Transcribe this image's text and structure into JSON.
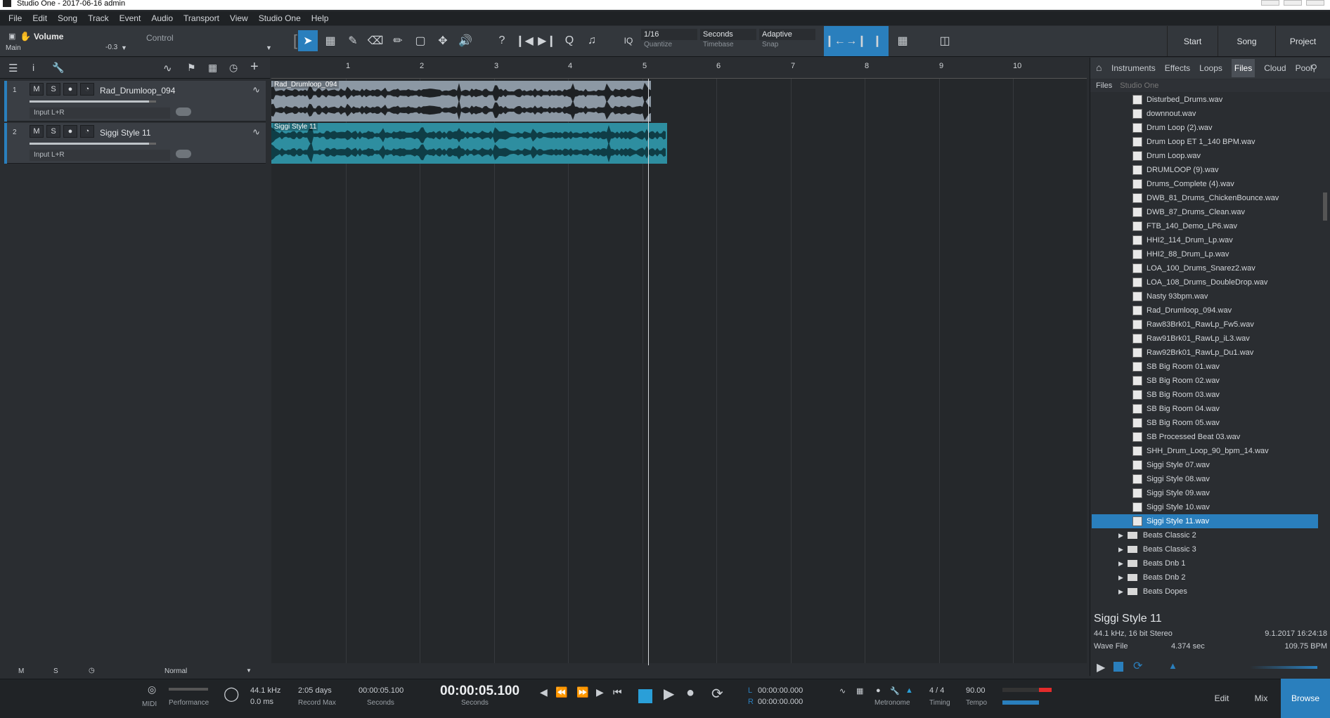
{
  "window": {
    "title": "Studio One - 2017-06-16 admin"
  },
  "menu": [
    "File",
    "Edit",
    "Song",
    "Track",
    "Event",
    "Audio",
    "Transport",
    "View",
    "Studio One",
    "Help"
  ],
  "toolbar": {
    "volume_label": "Volume",
    "main_label": "Main",
    "db_value": "-0.3",
    "control_label": "Control",
    "quantize_value": "1/16",
    "quantize_label": "Quantize",
    "timebase_value": "Seconds",
    "timebase_label": "Timebase",
    "snap_value": "Adaptive",
    "snap_label": "Snap",
    "iq_label": "IQ",
    "start": "Start",
    "song": "Song",
    "project": "Project"
  },
  "tracks": [
    {
      "num": "1",
      "name": "Rad_Drumloop_094",
      "input": "Input L+R"
    },
    {
      "num": "2",
      "name": "Siggi Style 11",
      "input": "Input L+R"
    }
  ],
  "track_buttons": {
    "mute": "M",
    "solo": "S"
  },
  "ruler": [
    "1",
    "2",
    "3",
    "4",
    "5",
    "6",
    "7",
    "8",
    "9",
    "10"
  ],
  "clips": [
    {
      "label": "Rad_Drumloop_094",
      "color": "#8c98a4"
    },
    {
      "label": "Siggi Style 11",
      "color": "#2e8ea0"
    }
  ],
  "browser": {
    "tabs": [
      "Instruments",
      "Effects",
      "Loops",
      "Files",
      "Cloud",
      "Pool"
    ],
    "active_tab": "Files",
    "sub_files": "Files",
    "sub_studio": "Studio One",
    "files": [
      "Disturbed_Drums.wav",
      "downnout.wav",
      "Drum Loop (2).wav",
      "Drum Loop ET 1_140 BPM.wav",
      "Drum Loop.wav",
      "DRUMLOOP (9).wav",
      "Drums_Complete (4).wav",
      "DWB_81_Drums_ChickenBounce.wav",
      "DWB_87_Drums_Clean.wav",
      "FTB_140_Demo_LP6.wav",
      "HHI2_114_Drum_Lp.wav",
      "HHI2_88_Drum_Lp.wav",
      "LOA_100_Drums_Snarez2.wav",
      "LOA_108_Drums_DoubleDrop.wav",
      "Nasty 93bpm.wav",
      "Rad_Drumloop_094.wav",
      "Raw83Brk01_RawLp_Fw5.wav",
      "Raw91Brk01_RawLp_iL3.wav",
      "Raw92Brk01_RawLp_Du1.wav",
      "SB Big Room 01.wav",
      "SB Big Room 02.wav",
      "SB Big Room 03.wav",
      "SB Big Room 04.wav",
      "SB Big Room 05.wav",
      "SB Processed Beat 03.wav",
      "SHH_Drum_Loop_90_bpm_14.wav",
      "Siggi Style 07.wav",
      "Siggi Style 08.wav",
      "Siggi Style 09.wav",
      "Siggi Style 10.wav",
      "Siggi Style 11.wav"
    ],
    "selected_file": "Siggi Style 11.wav",
    "folders": [
      "Beats Classic 2",
      "Beats Classic 3",
      "Beats Dnb 1",
      "Beats Dnb 2",
      "Beats Dopes"
    ]
  },
  "info": {
    "title": "Siggi Style 11",
    "format": "44.1 kHz, 16 bit Stereo",
    "date": "9.1.2017 16:24:18",
    "type": "Wave File",
    "duration": "4.374 sec",
    "bpm": "109.75 BPM"
  },
  "bottom": {
    "m": "M",
    "s": "S",
    "mode": "Normal"
  },
  "transport": {
    "midi": "MIDI",
    "performance": "Performance",
    "sample_rate": "44.1 kHz",
    "latency": "0.0 ms",
    "record_max_value": "2:05 days",
    "record_max": "Record Max",
    "seconds_small": "00:00:05.100",
    "seconds_label": "Seconds",
    "main_time": "00:00:05.100",
    "main_time_label": "Seconds",
    "loop_l": "00:00:00.000",
    "loop_r": "00:00:00.000",
    "l": "L",
    "r": "R",
    "metronome": "Metronome",
    "timing_value": "4 / 4",
    "timing": "Timing",
    "tempo_value": "90.00",
    "tempo": "Tempo"
  },
  "views": {
    "edit": "Edit",
    "mix": "Mix",
    "browse": "Browse"
  },
  "colors": {
    "accent": "#2a7fbd",
    "clip_audio": "#2e8ea0",
    "clip_gray": "#8c98a4",
    "record": "#e32b2b"
  }
}
